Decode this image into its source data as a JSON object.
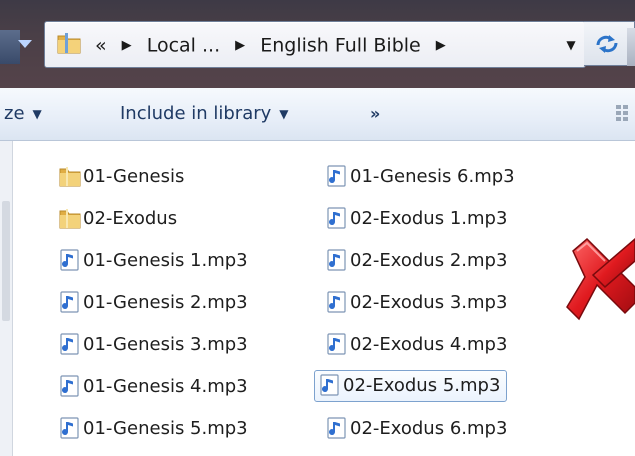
{
  "addressbar": {
    "overflow": "«",
    "crumbs": [
      "Local ...",
      "English Full Bible"
    ]
  },
  "toolbar": {
    "organize_partial": "ze",
    "include_in_library": "Include in library",
    "more": "»"
  },
  "files": {
    "column1": [
      {
        "name": "01-Genesis",
        "type": "folder"
      },
      {
        "name": "02-Exodus",
        "type": "folder"
      },
      {
        "name": "01-Genesis 1.mp3",
        "type": "mp3"
      },
      {
        "name": "01-Genesis 2.mp3",
        "type": "mp3"
      },
      {
        "name": "01-Genesis 3.mp3",
        "type": "mp3"
      },
      {
        "name": "01-Genesis 4.mp3",
        "type": "mp3"
      },
      {
        "name": "01-Genesis 5.mp3",
        "type": "mp3"
      }
    ],
    "column2": [
      {
        "name": "01-Genesis 6.mp3",
        "type": "mp3"
      },
      {
        "name": "02-Exodus 1.mp3",
        "type": "mp3"
      },
      {
        "name": "02-Exodus 2.mp3",
        "type": "mp3"
      },
      {
        "name": "02-Exodus 3.mp3",
        "type": "mp3"
      },
      {
        "name": "02-Exodus 4.mp3",
        "type": "mp3"
      },
      {
        "name": "02-Exodus 5.mp3",
        "type": "mp3",
        "selected": true
      },
      {
        "name": "02-Exodus 6.mp3",
        "type": "mp3"
      }
    ]
  },
  "colors": {
    "accent_text": "#1f3a64",
    "selection_border": "#7da2ce",
    "error_mark": "#d4141a"
  },
  "icons": [
    "folder-icon",
    "mp3-file-icon",
    "refresh-icon",
    "view-options-icon",
    "red-x-icon"
  ]
}
